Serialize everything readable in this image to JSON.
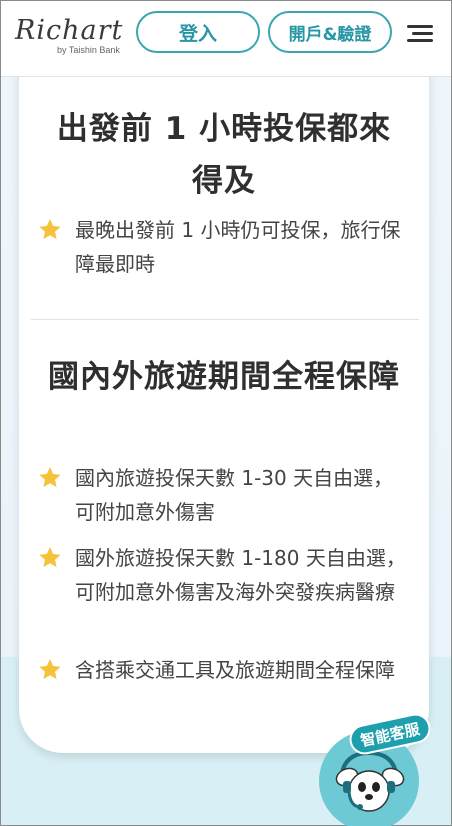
{
  "header": {
    "logo_text": "Richart",
    "logo_sub": "by Taishin Bank",
    "login_label": "登入",
    "open_account_label": "開戶&驗證",
    "menu_icon": "hamburger-menu-icon"
  },
  "sections": [
    {
      "title": "出發前 1 小時投保都來得及",
      "items": [
        {
          "icon": "star-icon",
          "text": "最晚出發前 1 小時仍可投保，旅行保障最即時"
        }
      ]
    },
    {
      "title": "國內外旅遊期間全程保障",
      "items": [
        {
          "icon": "star-icon",
          "text": "國內旅遊投保天數 1-30 天自由選，可附加意外傷害"
        },
        {
          "icon": "star-icon",
          "text": "國外旅遊投保天數 1-180 天自由選，可附加意外傷害及海外突發疾病醫療"
        },
        {
          "icon": "star-icon",
          "text": "含搭乘交通工具及旅遊期間全程保障"
        }
      ]
    }
  ],
  "chat_bot": {
    "badge_label": "智能客服",
    "icon": "chatbot-dog-icon"
  },
  "colors": {
    "accent": "#2796a5",
    "star": "#f5c23c",
    "background_top": "#eef6fb",
    "background_bottom": "#d8f0f5"
  }
}
